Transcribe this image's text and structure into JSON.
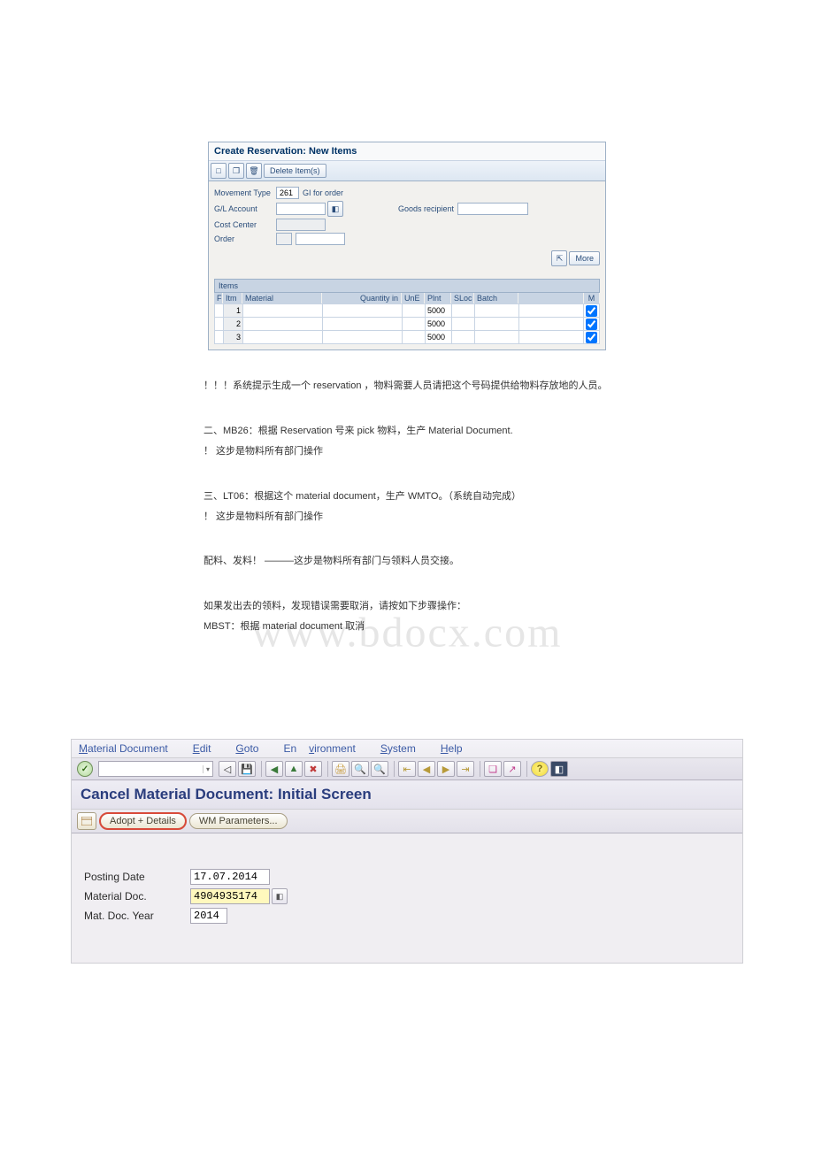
{
  "sap1": {
    "title": "Create Reservation: New Items",
    "delete_btn": "Delete Item(s)",
    "fields": {
      "movement_type_lbl": "Movement Type",
      "movement_type_val": "261",
      "movement_type_txt": "GI for order",
      "gl_account_lbl": "G/L Account",
      "cost_center_lbl": "Cost Center",
      "order_lbl": "Order",
      "goods_recipient_lbl": "Goods recipient"
    },
    "more_btn": "More",
    "items_header": "Items",
    "cols": {
      "f": "F",
      "itm": "Itm",
      "material": "Material",
      "qty_in": "Quantity in",
      "une": "UnE",
      "plnt": "Plnt",
      "sloc": "SLoc",
      "batch": "Batch",
      "m": "M"
    },
    "rows": [
      {
        "n": "1",
        "plnt": "5000"
      },
      {
        "n": "2",
        "plnt": "5000"
      },
      {
        "n": "3",
        "plnt": "5000"
      }
    ]
  },
  "doc": {
    "l1": "！！！系统提示生成一个 reservation ，物料需要人员请把这个号码提供给物料存放地的人员。",
    "l2": "二、MB26：根据 Reservation 号来 pick 物料，生产 Material Document.",
    "l3": "！ 这步是物料所有部门操作",
    "l4": "三、LT06：根据这个 material document，生产 WMTO。（系统自动完成）",
    "l5": "！ 这步是物料所有部门操作",
    "l6": "配料、发料！ ———这步是物料所有部门与领料人员交接。",
    "l7": "如果发出去的领料，发现错误需要取消，请按如下步骤操作：",
    "l8": "MBST：根据 material document 取消",
    "watermark": "www.bdocx.com"
  },
  "sap2": {
    "menu": {
      "m1a": "M",
      "m1b": "aterial Document",
      "m2a": "E",
      "m2b": "dit",
      "m3a": "G",
      "m3b": "oto",
      "m4a": "En",
      "m4b": "v",
      "m4c": "ironment",
      "m5a": "S",
      "m5b": "ystem",
      "m6a": "H",
      "m6b": "elp"
    },
    "title": "Cancel Material Document: Initial Screen",
    "btn_adopt": "Adopt + Details",
    "btn_wm": "WM Parameters...",
    "fields": {
      "posting_date_lbl": "Posting Date",
      "posting_date_val": "17.07.2014",
      "mat_doc_lbl": "Material Doc.",
      "mat_doc_val": "4904935174",
      "mat_year_lbl": "Mat. Doc. Year",
      "mat_year_val": "2014"
    }
  }
}
